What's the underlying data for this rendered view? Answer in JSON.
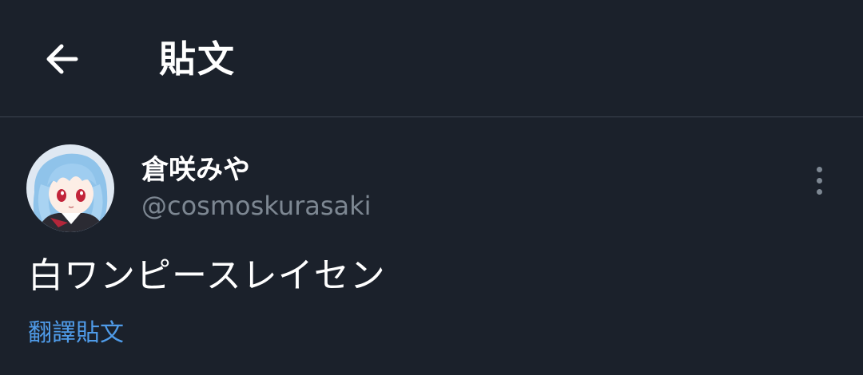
{
  "header": {
    "title": "貼文",
    "back_icon": "arrow-left-icon"
  },
  "post": {
    "author": {
      "display_name": "倉咲みや",
      "handle": "@cosmoskurasaki",
      "avatar": "anime-girl-avatar"
    },
    "more_icon": "more-vertical-icon",
    "text": "白ワンピースレイセン",
    "translate_label": "翻譯貼文"
  },
  "colors": {
    "background": "#1b212b",
    "divider": "#3d4550",
    "primary_text": "#ffffff",
    "secondary_text": "#7d8792",
    "link": "#4f9be8"
  }
}
